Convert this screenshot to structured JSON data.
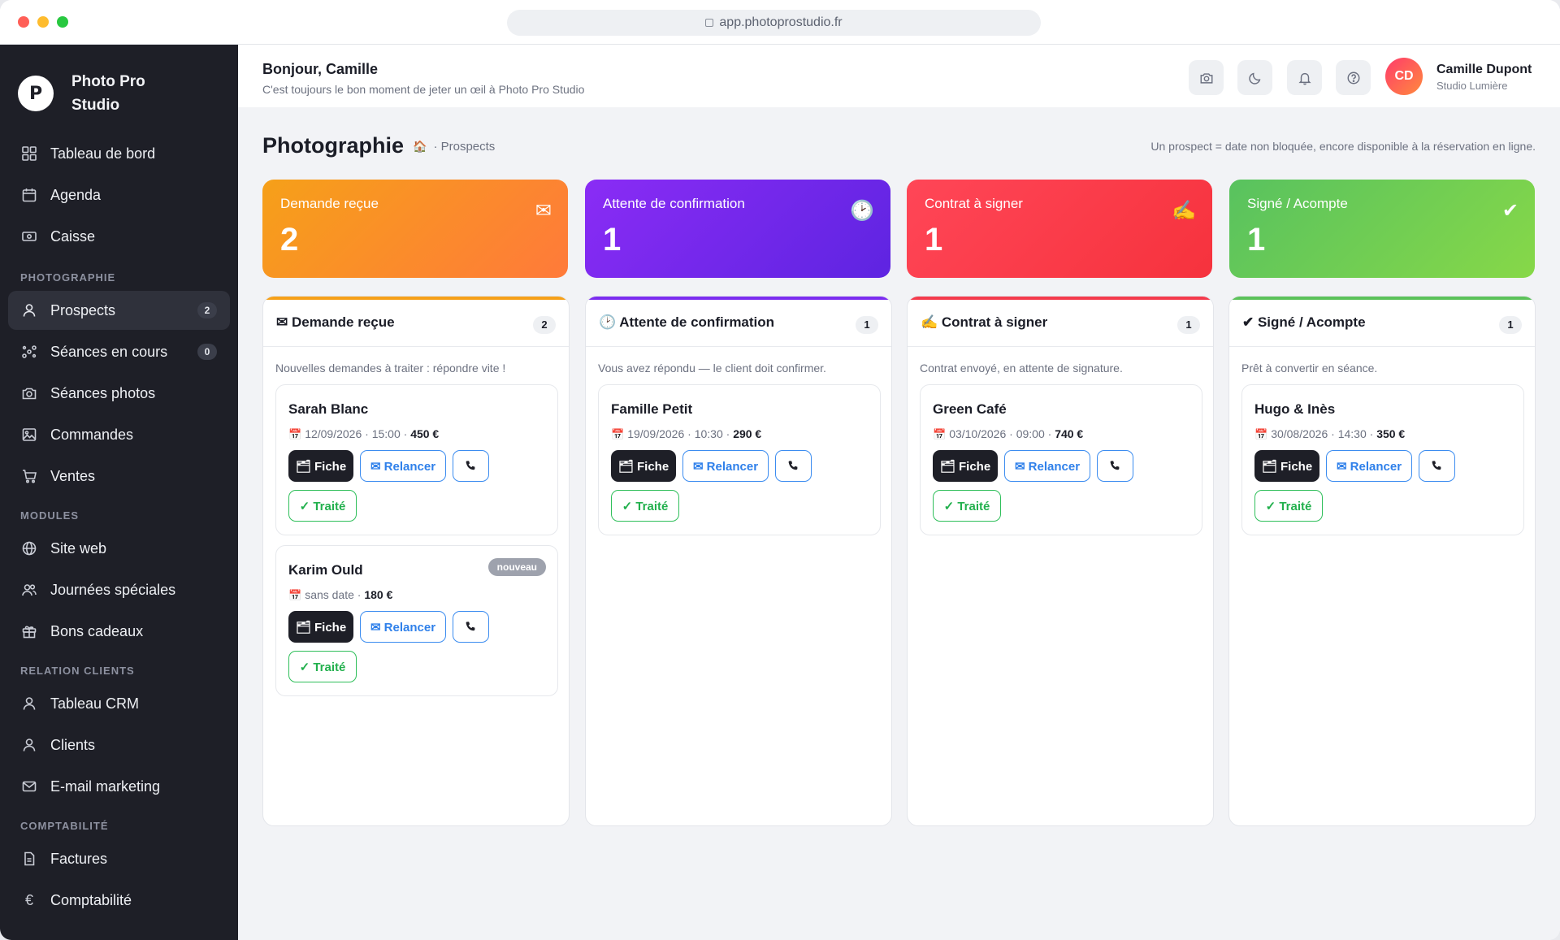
{
  "browser": {
    "url": "app.photoprostudio.fr"
  },
  "brand": {
    "logo_letter": "P",
    "name": "Photo Pro Studio"
  },
  "sidebar": {
    "items": [
      {
        "label": "Tableau de bord",
        "icon": "dashboard-icon"
      },
      {
        "label": "Agenda",
        "icon": "calendar-icon"
      },
      {
        "label": "Caisse",
        "icon": "cash-icon"
      }
    ],
    "sections": [
      {
        "title": "PHOTOGRAPHIE",
        "items": [
          {
            "label": "Prospects",
            "icon": "user-icon",
            "badge": "2",
            "active": true
          },
          {
            "label": "Séances en cours",
            "icon": "flow-icon",
            "badge": "0"
          },
          {
            "label": "Séances photos",
            "icon": "camera-icon"
          },
          {
            "label": "Commandes",
            "icon": "image-icon"
          },
          {
            "label": "Ventes",
            "icon": "cart-icon"
          }
        ]
      },
      {
        "title": "MODULES",
        "items": [
          {
            "label": "Site web",
            "icon": "globe-icon"
          },
          {
            "label": "Journées spéciales",
            "icon": "users-icon"
          },
          {
            "label": "Bons cadeaux",
            "icon": "gift-icon"
          }
        ]
      },
      {
        "title": "RELATION CLIENTS",
        "items": [
          {
            "label": "Tableau CRM",
            "icon": "user-icon"
          },
          {
            "label": "Clients",
            "icon": "user-icon"
          },
          {
            "label": "E-mail marketing",
            "icon": "mail-icon"
          }
        ]
      },
      {
        "title": "COMPTABILITÉ",
        "items": [
          {
            "label": "Factures",
            "icon": "document-icon"
          },
          {
            "label": "Comptabilité",
            "icon": "euro-icon"
          }
        ]
      }
    ]
  },
  "header": {
    "greeting": "Bonjour, Camille",
    "subtitle": "C'est toujours le bon moment de jeter un œil à Photo Pro Studio",
    "user": {
      "initials": "CD",
      "name": "Camille Dupont",
      "studio": "Studio Lumière"
    }
  },
  "page": {
    "title": "Photographie",
    "breadcrumb": "· Prospects",
    "note": "Un prospect = date non bloquée, encore disponible à la réservation en ligne."
  },
  "stats": [
    {
      "label": "Demande reçue",
      "value": "2",
      "icon": "✉"
    },
    {
      "label": "Attente de confirmation",
      "value": "1",
      "icon": "🕑"
    },
    {
      "label": "Contrat à signer",
      "value": "1",
      "icon": "✍"
    },
    {
      "label": "Signé / Acompte",
      "value": "1",
      "icon": "✔"
    }
  ],
  "buttons": {
    "fiche": "🗂 Fiche",
    "relancer": "✉ Relancer",
    "traite": "✓ Traité"
  },
  "columns": [
    {
      "title": "✉ Demande reçue",
      "count": "2",
      "accent": "#f6a019",
      "description": "Nouvelles demandes à traiter : répondre vite !",
      "cards": [
        {
          "name": "Sarah Blanc",
          "date": "12/09/2026 · 15:00",
          "price": "450 €"
        },
        {
          "name": "Karim Ould",
          "date": "sans date",
          "price": "180 €",
          "badge": "nouveau"
        }
      ]
    },
    {
      "title": "🕑 Attente de confirmation",
      "count": "1",
      "accent": "#7c2cf0",
      "description": "Vous avez répondu — le client doit confirmer.",
      "cards": [
        {
          "name": "Famille Petit",
          "date": "19/09/2026 · 10:30",
          "price": "290 €"
        }
      ]
    },
    {
      "title": "✍ Contrat à signer",
      "count": "1",
      "accent": "#f43a4c",
      "description": "Contrat envoyé, en attente de signature.",
      "cards": [
        {
          "name": "Green Café",
          "date": "03/10/2026 · 09:00",
          "price": "740 €"
        }
      ]
    },
    {
      "title": "✔ Signé / Acompte",
      "count": "1",
      "accent": "#5cc25a",
      "description": "Prêt à convertir en séance.",
      "cards": [
        {
          "name": "Hugo & Inès",
          "date": "30/08/2026 · 14:30",
          "price": "350 €"
        }
      ]
    }
  ]
}
